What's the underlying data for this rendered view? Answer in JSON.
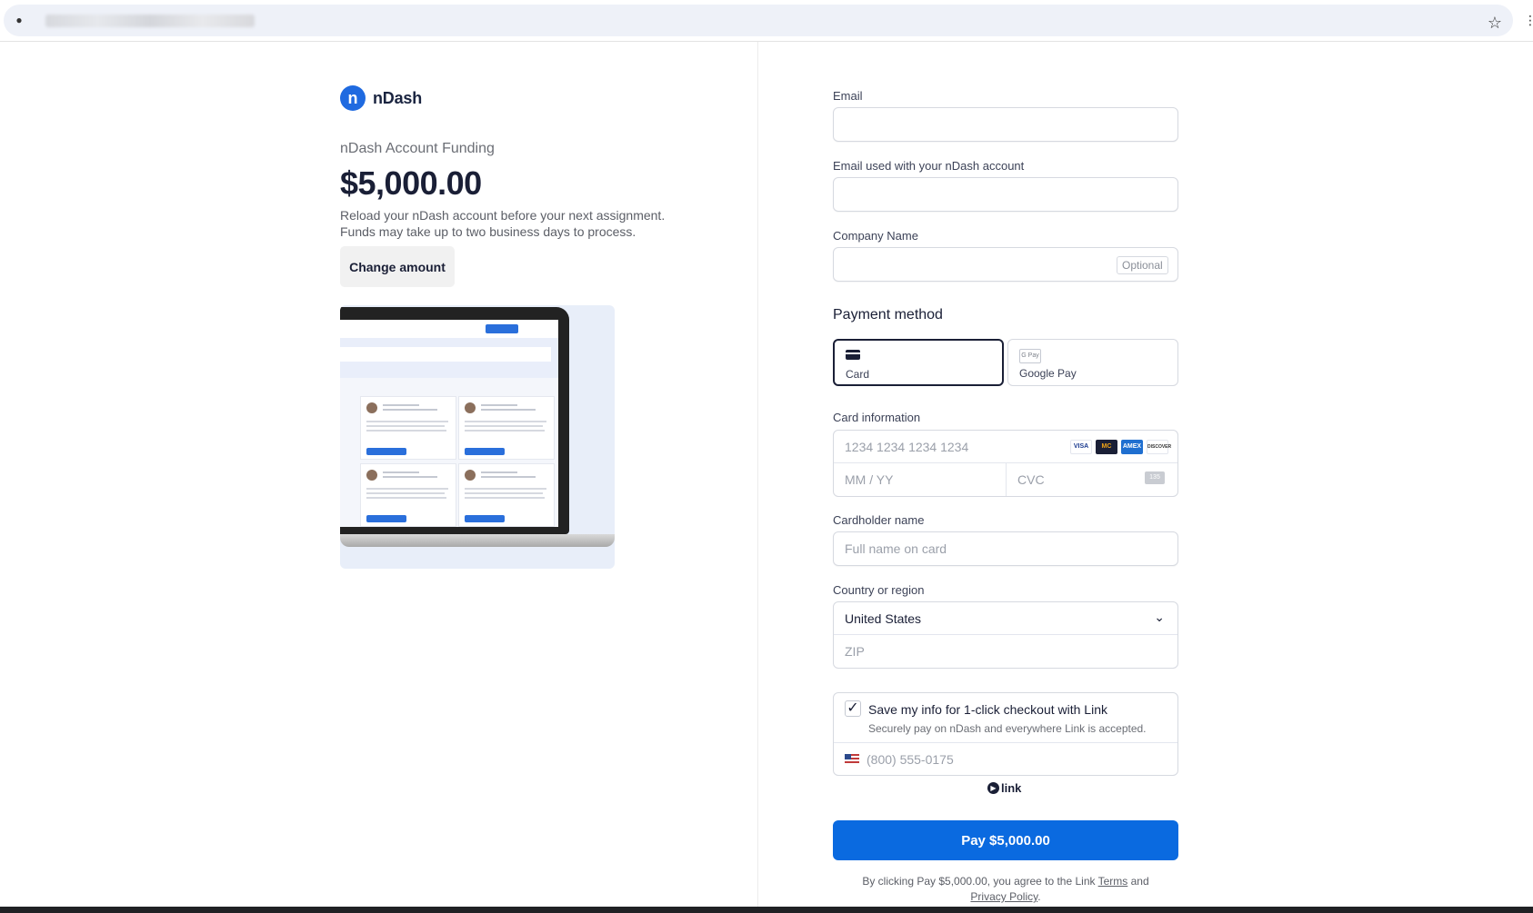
{
  "browser": {
    "star_icon": "star-icon"
  },
  "merchant": {
    "logo_letter": "n",
    "name": "nDash",
    "product": "nDash Account Funding",
    "price": "$5,000.00",
    "description_line1": "Reload your nDash account before your next assignment.",
    "description_line2": "Funds may take up to two business days to process.",
    "change_amount_label": "Change amount"
  },
  "form": {
    "email_label": "Email",
    "email_value": "",
    "account_email_label": "Email used with your nDash account",
    "account_email_value": "",
    "company_label": "Company Name",
    "company_value": "",
    "optional_tag": "Optional",
    "payment_method_title": "Payment method",
    "payment_methods": [
      {
        "label": "Card",
        "icon": "card-icon",
        "selected": true
      },
      {
        "label": "Google Pay",
        "icon": "google-pay-icon",
        "selected": false
      }
    ],
    "card_info_label": "Card information",
    "card_number_placeholder": "1234 1234 1234 1234",
    "card_brands": [
      "VISA",
      "MC",
      "AMEX",
      "DISCOVER"
    ],
    "expiry_placeholder": "MM / YY",
    "cvc_placeholder": "CVC",
    "cvc_icon_text": "135",
    "cardholder_label": "Cardholder name",
    "cardholder_placeholder": "Full name on card",
    "country_label": "Country or region",
    "country_value": "United States",
    "zip_placeholder": "ZIP",
    "link_checkbox_checked": true,
    "link_title": "Save my info for 1-click checkout with Link",
    "link_subtitle": "Securely pay on nDash and everywhere Link is accepted.",
    "phone_placeholder": "(800) 555-0175",
    "link_brand": "link",
    "pay_button_label": "Pay $5,000.00",
    "legal_prefix": "By clicking Pay $5,000.00, you agree to the Link ",
    "legal_terms": "Terms",
    "legal_and": " and",
    "legal_privacy": "Privacy Policy",
    "legal_suffix": "."
  },
  "colors": {
    "accent": "#0a6ae0",
    "brand": "#1f6ae0",
    "text": "#1a1f36",
    "border": "#d6d9e0"
  }
}
